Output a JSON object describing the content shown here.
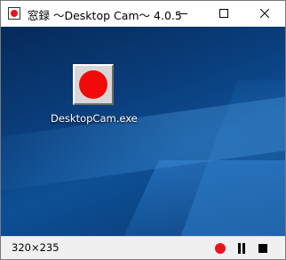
{
  "window": {
    "title": "窓録 ～Desktop Cam～ 4.0.5",
    "icon": "record-dot-icon"
  },
  "caption_buttons": {
    "minimize_icon": "minimize-icon",
    "maximize_icon": "maximize-icon",
    "close_icon": "close-icon"
  },
  "desktop": {
    "icon_label": "DesktopCam.exe",
    "icon": "record-app-icon",
    "accent_color": "#f20a0a"
  },
  "statusbar": {
    "size_text": "320×235",
    "controls": {
      "record_icon": "record-icon",
      "pause_icon": "pause-icon",
      "stop_icon": "stop-icon",
      "record_color": "#e8141c"
    }
  }
}
